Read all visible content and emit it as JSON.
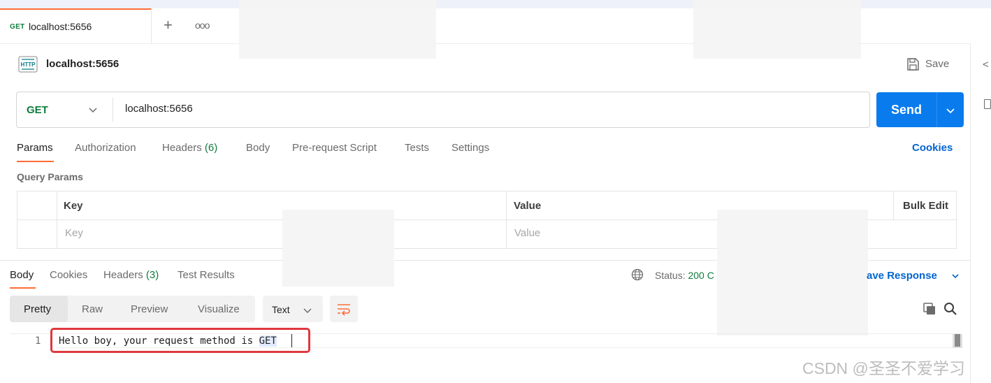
{
  "tabbar": {
    "tab": {
      "method": "GET",
      "title": "localhost:5656"
    },
    "new_tab_symbol": "+",
    "more_symbol": "ooo"
  },
  "request": {
    "title": "localhost:5656",
    "save_label": "Save",
    "method": "GET",
    "url": "localhost:5656",
    "send_label": "Send",
    "tabs": [
      {
        "label": "Params",
        "active": true
      },
      {
        "label": "Authorization"
      },
      {
        "label": "Headers",
        "count": "(6)"
      },
      {
        "label": "Body"
      },
      {
        "label": "Pre-request Script"
      },
      {
        "label": "Tests"
      },
      {
        "label": "Settings"
      }
    ],
    "cookies_label": "Cookies",
    "query_params": {
      "title": "Query Params",
      "key_header": "Key",
      "value_header": "Value",
      "bulk_edit_label": "Bulk Edit",
      "key_placeholder": "Key",
      "value_placeholder": "Value"
    }
  },
  "response": {
    "tabs": [
      {
        "label": "Body",
        "active": true
      },
      {
        "label": "Cookies"
      },
      {
        "label": "Headers",
        "count": "(3)"
      },
      {
        "label": "Test Results"
      }
    ],
    "status_label": "Status:",
    "status_value": "200 C",
    "save_response_label": "ave Response",
    "views": [
      "Pretty",
      "Raw",
      "Preview",
      "Visualize"
    ],
    "active_view": "Pretty",
    "format": "Text",
    "lines": [
      {
        "number": "1",
        "text_plain": "Hello boy, your request method is ",
        "text_selected": "GET"
      }
    ]
  },
  "watermark": "CSDN @圣圣不爱学习",
  "colors": {
    "accent": "#ff6c37",
    "send_blue": "#097bed",
    "link_blue": "#0265d2",
    "get_green": "#0f7c3c",
    "highlight_red": "#e0383e"
  }
}
